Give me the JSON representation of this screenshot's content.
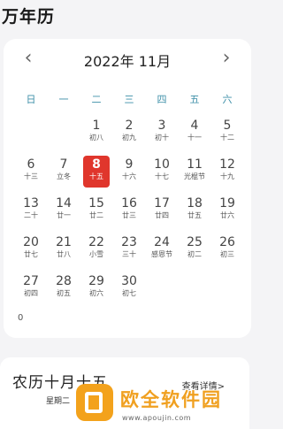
{
  "app": {
    "title": "万年历"
  },
  "calendar": {
    "month_title": "2022年 11月",
    "prev_icon": "chevron-left-icon",
    "next_icon": "chevron-right-icon",
    "weekdays": [
      "日",
      "一",
      "二",
      "三",
      "四",
      "五",
      "六"
    ],
    "accent_color": "#e0362c",
    "weekday_color": "#3d8fa8",
    "days": [
      {
        "num": "1",
        "lunar": "初八"
      },
      {
        "num": "2",
        "lunar": "初九"
      },
      {
        "num": "3",
        "lunar": "初十"
      },
      {
        "num": "4",
        "lunar": "十一"
      },
      {
        "num": "5",
        "lunar": "十二"
      },
      {
        "num": "6",
        "lunar": "十三"
      },
      {
        "num": "7",
        "lunar": "立冬"
      },
      {
        "num": "8",
        "lunar": "十五",
        "selected": true
      },
      {
        "num": "9",
        "lunar": "十六"
      },
      {
        "num": "10",
        "lunar": "十七"
      },
      {
        "num": "11",
        "lunar": "光棍节"
      },
      {
        "num": "12",
        "lunar": "十九"
      },
      {
        "num": "13",
        "lunar": "二十"
      },
      {
        "num": "14",
        "lunar": "廿一"
      },
      {
        "num": "15",
        "lunar": "廿二"
      },
      {
        "num": "16",
        "lunar": "廿三"
      },
      {
        "num": "17",
        "lunar": "廿四"
      },
      {
        "num": "18",
        "lunar": "廿五"
      },
      {
        "num": "19",
        "lunar": "廿六"
      },
      {
        "num": "20",
        "lunar": "廿七"
      },
      {
        "num": "21",
        "lunar": "廿八"
      },
      {
        "num": "22",
        "lunar": "小雪"
      },
      {
        "num": "23",
        "lunar": "三十"
      },
      {
        "num": "24",
        "lunar": "感恩节"
      },
      {
        "num": "25",
        "lunar": "初二"
      },
      {
        "num": "26",
        "lunar": "初三"
      },
      {
        "num": "27",
        "lunar": "初四"
      },
      {
        "num": "28",
        "lunar": "初五"
      },
      {
        "num": "29",
        "lunar": "初六"
      },
      {
        "num": "30",
        "lunar": "初七"
      }
    ],
    "count_label": "0"
  },
  "info": {
    "lunar_date": "农历十月十五",
    "detail_link": "查看详情>",
    "weekday_text": "星期二"
  },
  "watermark": {
    "name": "欧全软件园",
    "url": "www.apoujin.com"
  }
}
